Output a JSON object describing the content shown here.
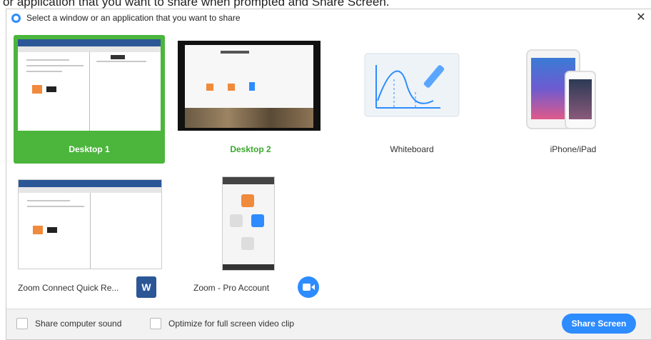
{
  "document": {
    "text_top": "or application that you want to share when prompted and Share Screen."
  },
  "dialog": {
    "title": "Select a window or an application that you want to share",
    "close_glyph": "✕",
    "tiles": [
      {
        "label": "Desktop 1",
        "selected": true
      },
      {
        "label": "Desktop 2",
        "selected": false
      },
      {
        "label": "Whiteboard",
        "selected": false
      },
      {
        "label": "iPhone/iPad",
        "selected": false
      },
      {
        "label": "Zoom Connect Quick Re...",
        "selected": false,
        "app_icon": "word-icon"
      },
      {
        "label": "Zoom - Pro Account",
        "selected": false,
        "app_icon": "zoom-icon"
      }
    ],
    "footer": {
      "share_sound_label": "Share computer sound",
      "optimize_label": "Optimize for full screen video clip",
      "share_button_label": "Share Screen"
    },
    "colors": {
      "selected": "#4bb53c",
      "accent": "#2d8cff",
      "word": "#2b5797"
    }
  }
}
